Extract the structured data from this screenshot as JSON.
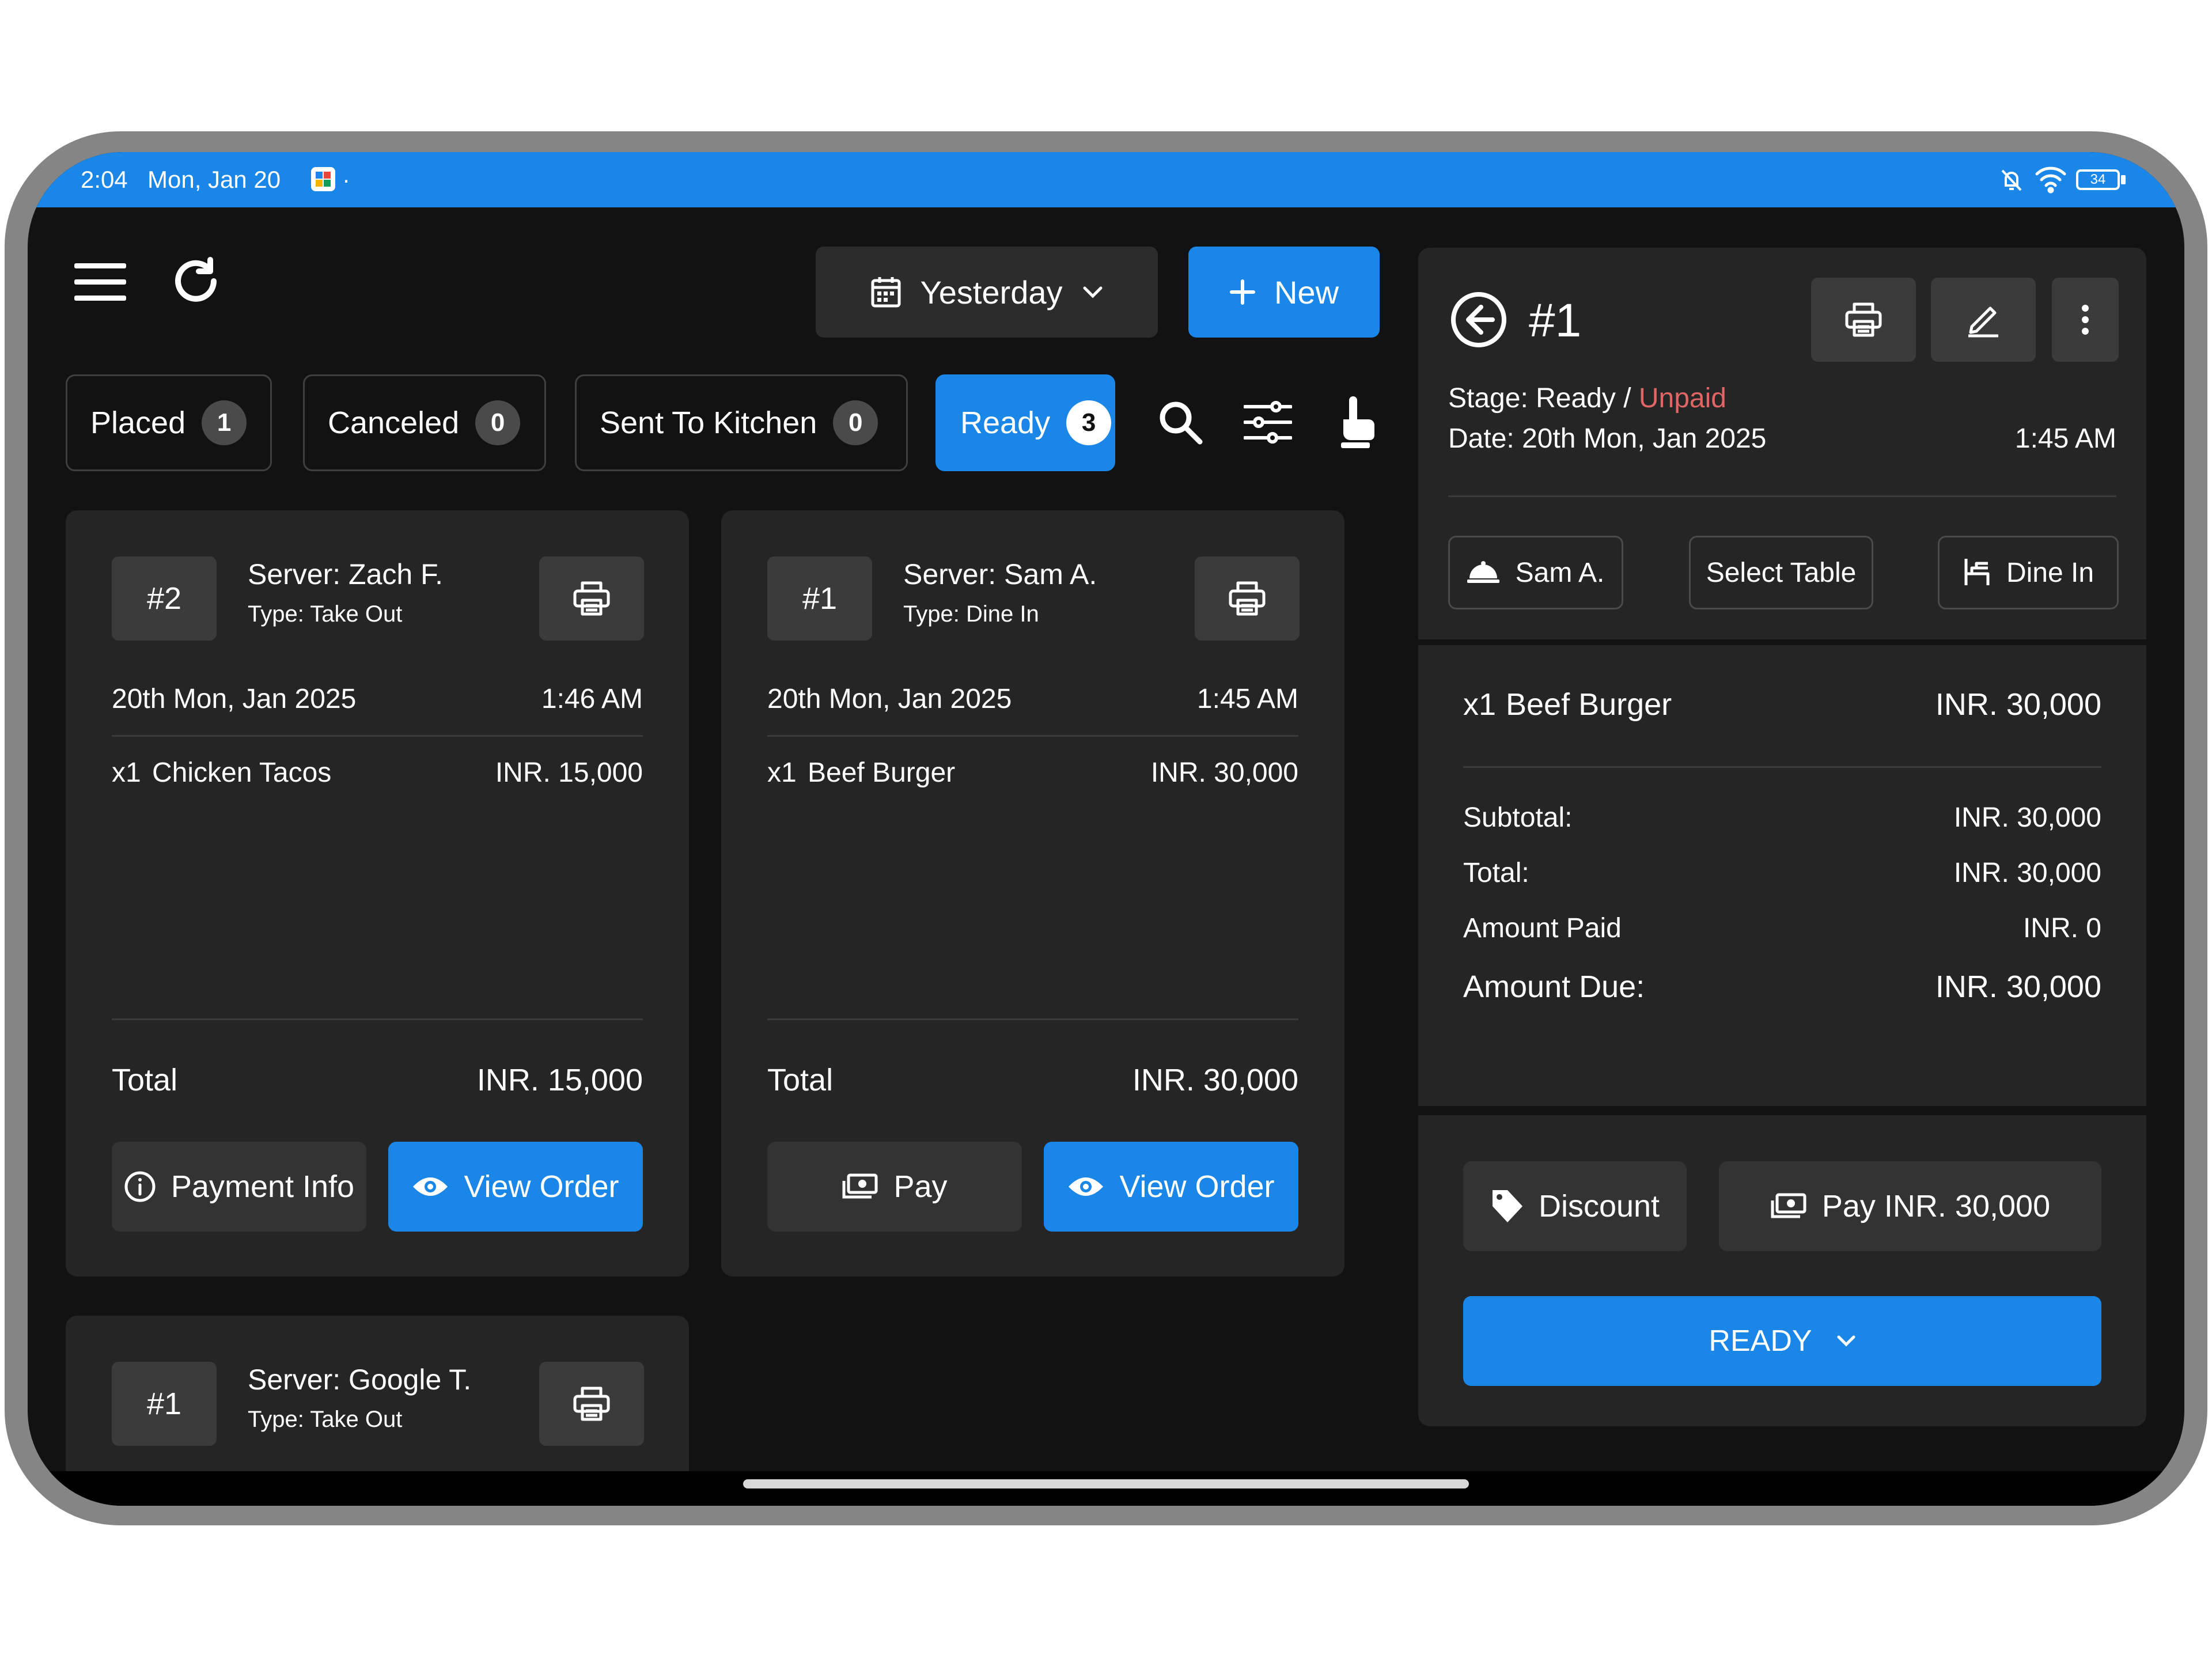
{
  "status_bar": {
    "time": "2:04",
    "date": "Mon, Jan 20",
    "dot": "·",
    "battery": "34"
  },
  "toolbar": {
    "date_filter": "Yesterday",
    "new_label": "New"
  },
  "filters": [
    {
      "label": "Placed",
      "count": "1"
    },
    {
      "label": "Canceled",
      "count": "0"
    },
    {
      "label": "Sent To Kitchen",
      "count": "0"
    },
    {
      "label": "Ready",
      "count": "3"
    }
  ],
  "orders": [
    {
      "id": "#2",
      "server": "Server: Zach F.",
      "type": "Type: Take Out",
      "date": "20th Mon, Jan 2025",
      "time": "1:46 AM",
      "item_qty": "x1",
      "item_name": "Chicken Tacos",
      "item_price": "INR. 15,000",
      "total_label": "Total",
      "total": "INR. 15,000",
      "secondary_action": "Payment Info",
      "primary_action": "View Order"
    },
    {
      "id": "#1",
      "server": "Server: Sam A.",
      "type": "Type: Dine In",
      "date": "20th Mon, Jan 2025",
      "time": "1:45 AM",
      "item_qty": "x1",
      "item_name": "Beef Burger",
      "item_price": "INR. 30,000",
      "total_label": "Total",
      "total": "INR. 30,000",
      "secondary_action": "Pay",
      "primary_action": "View Order"
    },
    {
      "id": "#1",
      "server": "Server: Google T.",
      "type": "Type: Take Out"
    }
  ],
  "detail": {
    "order_id": "#1",
    "stage_label": "Stage: Ready / ",
    "payment_status": "Unpaid",
    "date": "Date: 20th Mon, Jan 2025",
    "time": "1:45 AM",
    "server": "Sam A.",
    "table": "Select Table",
    "dining": "Dine In",
    "item_qty": "x1",
    "item_name": "Beef Burger",
    "item_price": "INR. 30,000",
    "subtotal_label": "Subtotal:",
    "subtotal": "INR. 30,000",
    "total_label": "Total:",
    "total": "INR. 30,000",
    "paid_label": "Amount Paid",
    "paid": "INR. 0",
    "due_label": "Amount Due:",
    "due": "INR. 30,000",
    "discount_label": "Discount",
    "pay_label": "Pay INR. 30,000",
    "status_button": "READY"
  },
  "colors": {
    "accent": "#1a86e8",
    "unpaid": "#e06666",
    "background": "#121212",
    "card": "#252525"
  }
}
